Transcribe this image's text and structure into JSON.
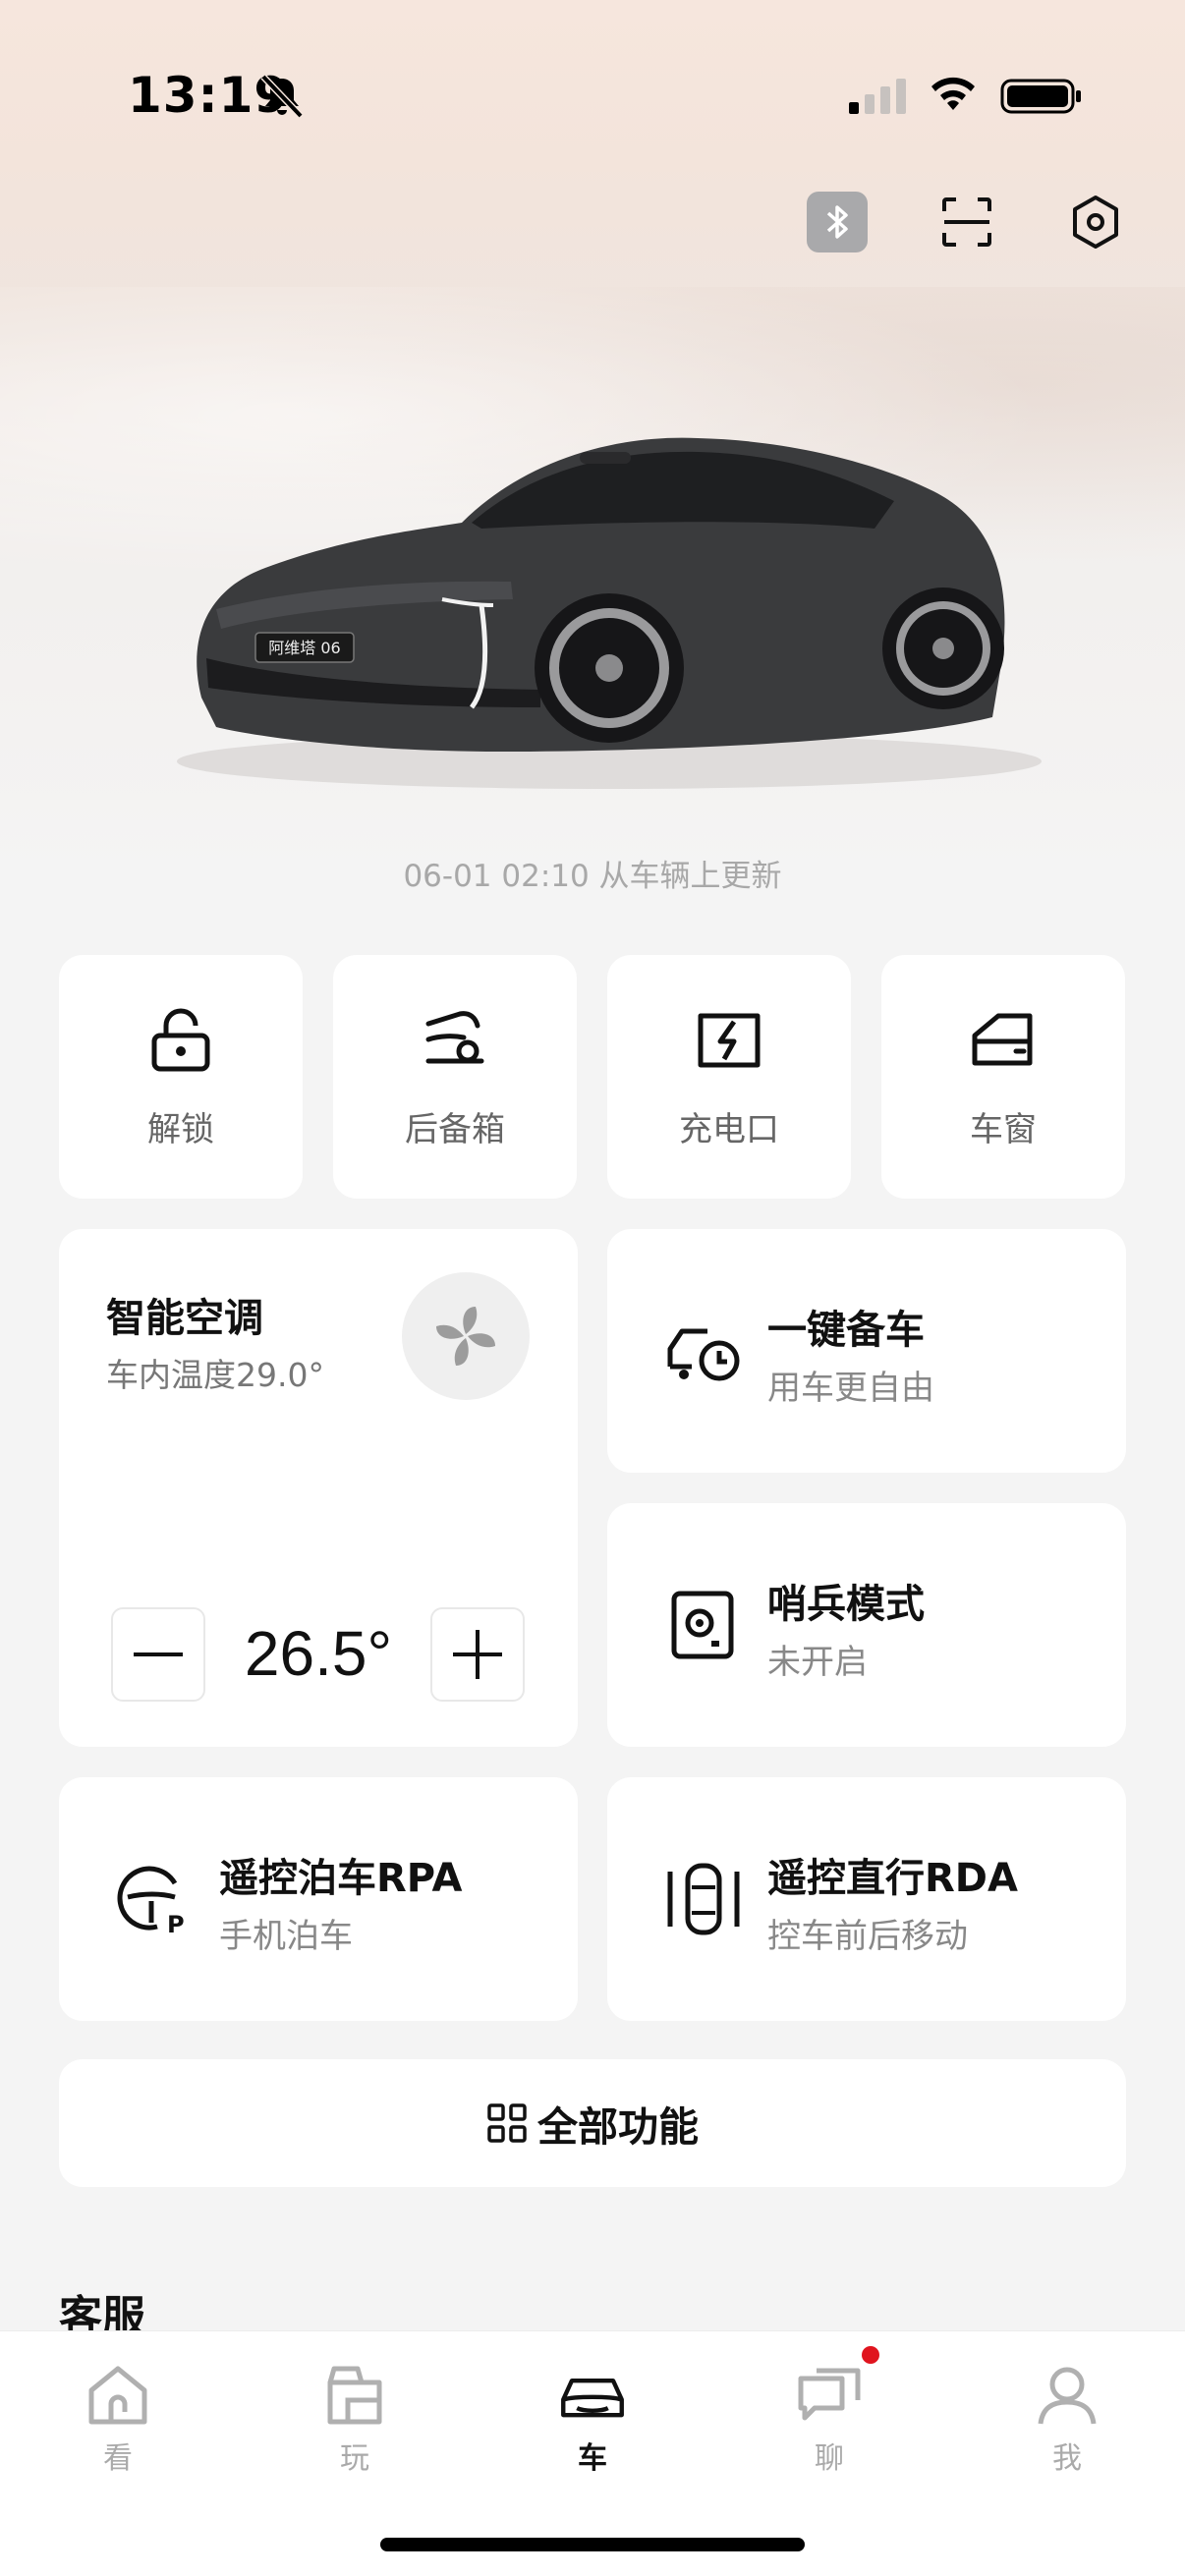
{
  "status_bar": {
    "time": "13:19"
  },
  "header": {
    "actions": [
      "bluetooth-icon",
      "scan-icon",
      "settings-icon"
    ]
  },
  "vehicle": {
    "plate_badge": "阿维塔 06",
    "update_text": "06-01 02:10 从车辆上更新"
  },
  "quick_actions": [
    {
      "label": "解锁",
      "icon": "unlock-icon"
    },
    {
      "label": "后备箱",
      "icon": "trunk-icon"
    },
    {
      "label": "充电口",
      "icon": "charge-port-icon"
    },
    {
      "label": "车窗",
      "icon": "window-icon"
    }
  ],
  "climate": {
    "title": "智能空调",
    "subtitle": "车内温度29.0°",
    "set_temp": "26.5°"
  },
  "features": [
    {
      "title": "一键备车",
      "subtitle": "用车更自由",
      "icon": "car-clock-icon"
    },
    {
      "title": "哨兵模式",
      "subtitle": "未开启",
      "icon": "sentry-icon"
    },
    {
      "title": "遥控泊车RPA",
      "subtitle": "手机泊车",
      "icon": "steering-parking-icon"
    },
    {
      "title": "遥控直行RDA",
      "subtitle": "控车前后移动",
      "icon": "remote-drive-icon"
    }
  ],
  "all_functions": {
    "label": "全部功能"
  },
  "section": {
    "title": "客服"
  },
  "tabs": [
    {
      "label": "看",
      "icon": "home-icon",
      "active": false
    },
    {
      "label": "玩",
      "icon": "bag-icon",
      "active": false
    },
    {
      "label": "车",
      "icon": "car-icon",
      "active": true
    },
    {
      "label": "聊",
      "icon": "chat-icon",
      "active": false,
      "badge": true
    },
    {
      "label": "我",
      "icon": "person-icon",
      "active": false
    }
  ],
  "colors": {
    "accent": "#111111",
    "badge": "#e0141e",
    "background": "#f4f4f4",
    "card": "#ffffff"
  }
}
